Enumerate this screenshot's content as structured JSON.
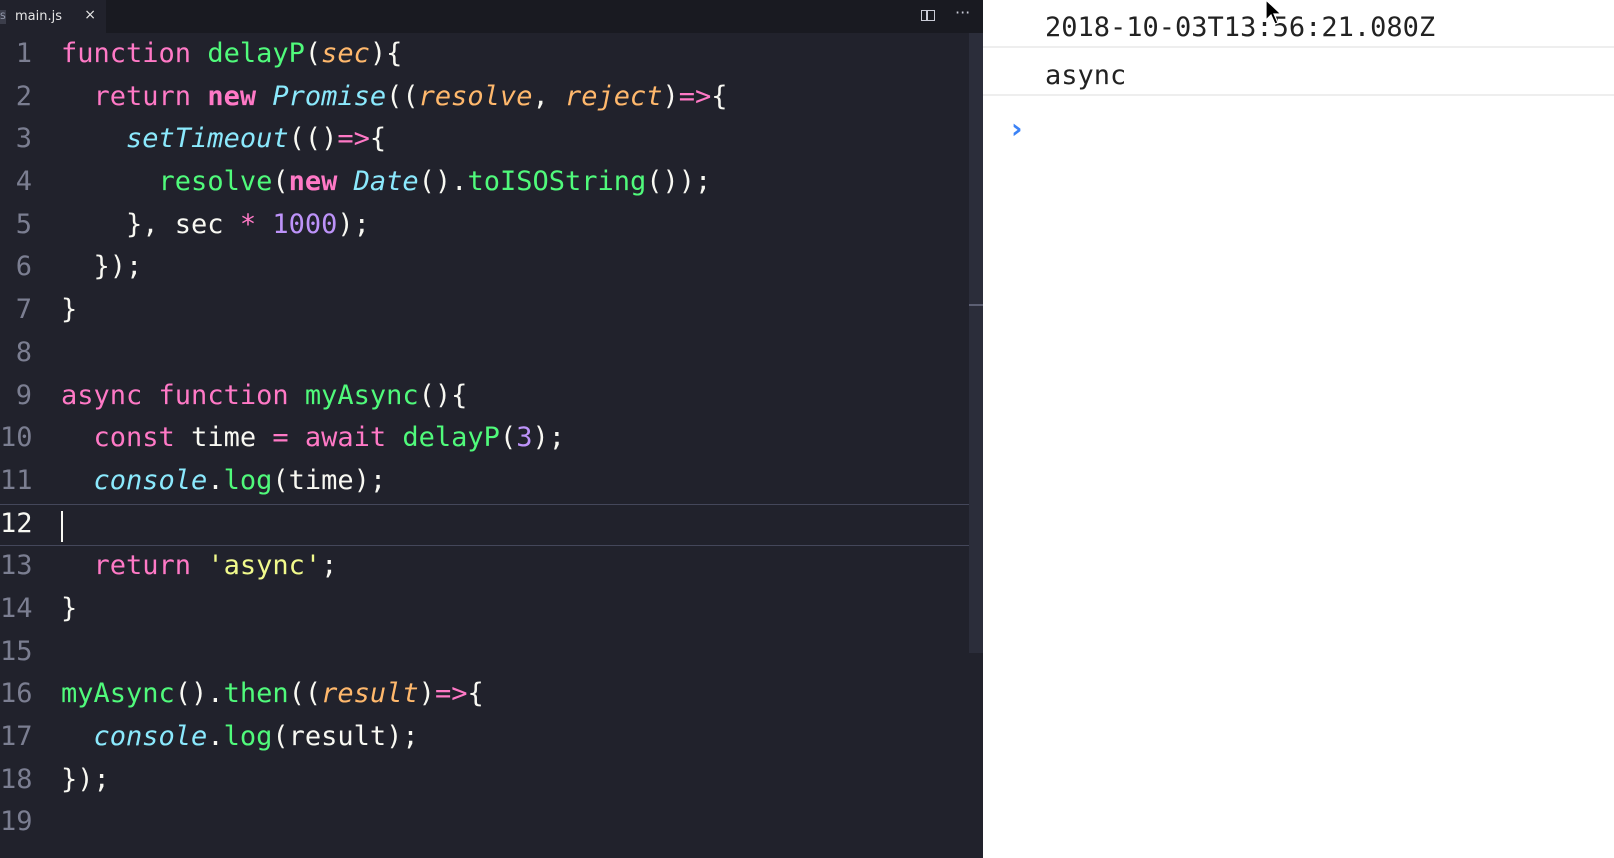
{
  "tab": {
    "label": "main.js",
    "close": "×",
    "icon_text": "S"
  },
  "toolbar": {
    "split_icon": "split-editor",
    "more": "···"
  },
  "editor": {
    "active_line": 12,
    "line_numbers": [
      "1",
      "2",
      "3",
      "4",
      "5",
      "6",
      "7",
      "8",
      "9",
      "10",
      "11",
      "12",
      "13",
      "14",
      "15",
      "16",
      "17",
      "18",
      "19"
    ]
  },
  "console": {
    "logs": [
      "2018-10-03T13:56:21.080Z",
      "async"
    ],
    "prompt": "›"
  },
  "colors": {
    "editor_bg": "#21222c",
    "keyword": "#ff79c6",
    "function": "#50fa7b",
    "param": "#ffb86c",
    "class": "#8be9fd",
    "number": "#bd93f9",
    "string": "#f1fa8c",
    "console_prompt": "#3b82f6"
  }
}
